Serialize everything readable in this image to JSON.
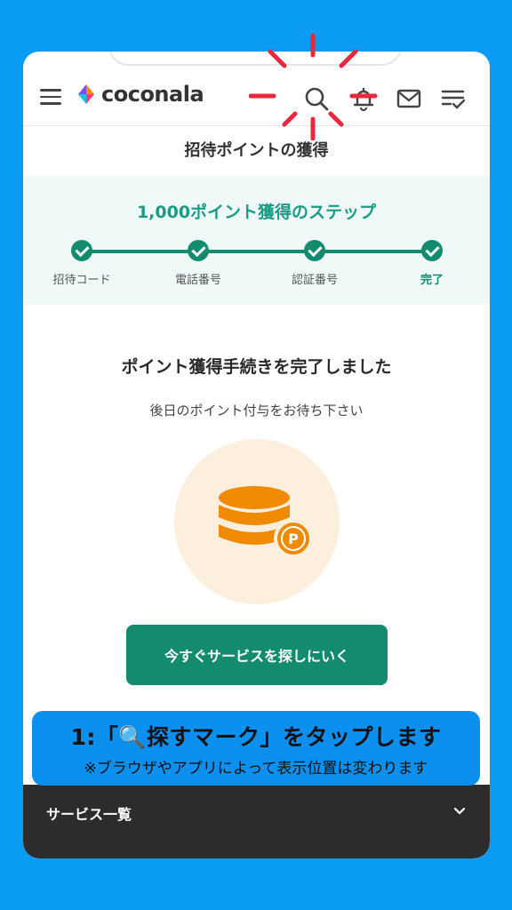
{
  "header": {
    "logo_text": "coconala",
    "icons": [
      "menu-icon",
      "search-icon",
      "bell-icon",
      "mail-icon",
      "checklist-icon"
    ]
  },
  "page_title": "招待ポイントの獲得",
  "steps": {
    "title": "1,000ポイント獲得のステップ",
    "items": [
      {
        "label": "招待コード"
      },
      {
        "label": "電話番号"
      },
      {
        "label": "認証番号"
      },
      {
        "label": "完了"
      }
    ],
    "accent_color": "#138b6e"
  },
  "main": {
    "headline": "ポイント獲得手続きを完了しました",
    "subline": "後日のポイント付与をお待ち下さい",
    "coin_badge": "P",
    "cta_label": "今すぐサービスを探しにいく"
  },
  "footer": {
    "label": "サービス一覧"
  },
  "callout": {
    "main": "1:「🔍探すマーク」をタップします",
    "sub": "※ブラウザやアプリによって表示位置は変わります"
  },
  "colors": {
    "background": "#0a9bf3",
    "primary": "#138b6e",
    "coin": "#f08a00",
    "highlight": "#e8283c",
    "footer": "#2c2c2c"
  }
}
